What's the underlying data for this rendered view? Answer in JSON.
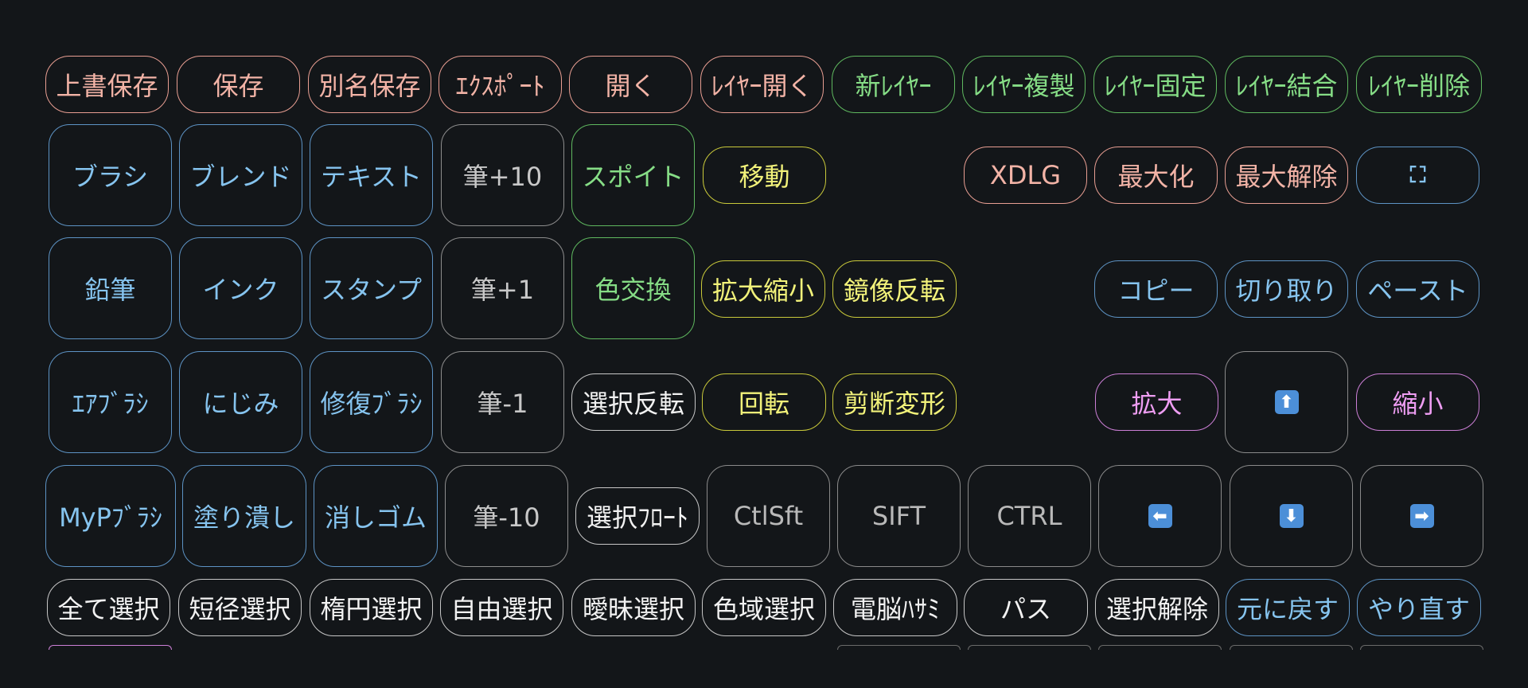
{
  "keys": [
    {
      "id": "overwrite-save",
      "label": "上書保存",
      "color": "pink"
    },
    {
      "id": "save",
      "label": "保存",
      "color": "pink"
    },
    {
      "id": "save-as",
      "label": "別名保存",
      "color": "pink"
    },
    {
      "id": "export",
      "label": "ｴｸｽﾎﾟｰﾄ",
      "color": "pink"
    },
    {
      "id": "open",
      "label": "開く",
      "color": "pink"
    },
    {
      "id": "open-layer",
      "label": "ﾚｲﾔｰ開く",
      "color": "pink"
    },
    {
      "id": "new-layer",
      "label": "新ﾚｲﾔｰ",
      "color": "green"
    },
    {
      "id": "duplicate-layer",
      "label": "ﾚｲﾔｰ複製",
      "color": "green"
    },
    {
      "id": "lock-layer",
      "label": "ﾚｲﾔｰ固定",
      "color": "green"
    },
    {
      "id": "merge-layer",
      "label": "ﾚｲﾔｰ結合",
      "color": "green"
    },
    {
      "id": "delete-layer",
      "label": "ﾚｲﾔｰ削除",
      "color": "green"
    },
    {
      "id": "brush",
      "label": "ブラシ",
      "color": "blue"
    },
    {
      "id": "blend",
      "label": "ブレンド",
      "color": "blue"
    },
    {
      "id": "text",
      "label": "テキスト",
      "color": "blue"
    },
    {
      "id": "brush-plus-10",
      "label": "筆+10",
      "color": "gray"
    },
    {
      "id": "eyedropper",
      "label": "スポイト",
      "color": "green"
    },
    {
      "id": "move",
      "label": "移動",
      "color": "yellow"
    },
    {
      "id": "xdlg",
      "label": "XDLG",
      "color": "pink"
    },
    {
      "id": "maximize",
      "label": "最大化",
      "color": "pink"
    },
    {
      "id": "unmaximize",
      "label": "最大解除",
      "color": "pink"
    },
    {
      "id": "fullscreen",
      "label": "⛶",
      "color": "blue"
    },
    {
      "id": "pencil",
      "label": "鉛筆",
      "color": "blue"
    },
    {
      "id": "ink",
      "label": "インク",
      "color": "blue"
    },
    {
      "id": "stamp",
      "label": "スタンプ",
      "color": "blue"
    },
    {
      "id": "brush-plus-1",
      "label": "筆+1",
      "color": "gray"
    },
    {
      "id": "color-swap",
      "label": "色交換",
      "color": "green"
    },
    {
      "id": "scale",
      "label": "拡大縮小",
      "color": "yellow"
    },
    {
      "id": "mirror",
      "label": "鏡像反転",
      "color": "yellow"
    },
    {
      "id": "copy",
      "label": "コピー",
      "color": "blue"
    },
    {
      "id": "cut",
      "label": "切り取り",
      "color": "blue"
    },
    {
      "id": "paste",
      "label": "ペースト",
      "color": "blue"
    },
    {
      "id": "airbrush",
      "label": "ｴｱﾌﾞﾗｼ",
      "color": "blue"
    },
    {
      "id": "blur",
      "label": "にじみ",
      "color": "blue"
    },
    {
      "id": "healing-brush",
      "label": "修復ﾌﾞﾗｼ",
      "color": "blue"
    },
    {
      "id": "brush-minus-1",
      "label": "筆-1",
      "color": "gray"
    },
    {
      "id": "invert-selection",
      "label": "選択反転",
      "color": "white"
    },
    {
      "id": "rotate",
      "label": "回転",
      "color": "yellow"
    },
    {
      "id": "shear",
      "label": "剪断変形",
      "color": "yellow"
    },
    {
      "id": "zoom-in",
      "label": "拡大",
      "color": "violet"
    },
    {
      "id": "arrow-up",
      "label": "⬆",
      "color": "darkgray",
      "icon": "arrow-up-icon"
    },
    {
      "id": "zoom-out",
      "label": "縮小",
      "color": "violet"
    },
    {
      "id": "my-brush",
      "label": "MyPﾌﾞﾗｼ",
      "color": "blue"
    },
    {
      "id": "fill",
      "label": "塗り潰し",
      "color": "blue"
    },
    {
      "id": "eraser",
      "label": "消しゴム",
      "color": "blue"
    },
    {
      "id": "brush-minus-10",
      "label": "筆-10",
      "color": "gray"
    },
    {
      "id": "float-selection",
      "label": "選択ﾌﾛｰﾄ",
      "color": "white"
    },
    {
      "id": "ctrl-shift",
      "label": "CtlSft",
      "color": "darkgray"
    },
    {
      "id": "shift",
      "label": "SIFT",
      "color": "darkgray"
    },
    {
      "id": "ctrl",
      "label": "CTRL",
      "color": "darkgray"
    },
    {
      "id": "arrow-left",
      "label": "⬅",
      "color": "darkgray",
      "icon": "arrow-left-icon"
    },
    {
      "id": "arrow-down",
      "label": "⬇",
      "color": "darkgray",
      "icon": "arrow-down-icon"
    },
    {
      "id": "arrow-right",
      "label": "➡",
      "color": "darkgray",
      "icon": "arrow-right-icon"
    },
    {
      "id": "select-all",
      "label": "全て選択",
      "color": "white"
    },
    {
      "id": "rect-select",
      "label": "短径選択",
      "color": "white"
    },
    {
      "id": "ellipse-select",
      "label": "楕円選択",
      "color": "white"
    },
    {
      "id": "free-select",
      "label": "自由選択",
      "color": "white"
    },
    {
      "id": "fuzzy-select",
      "label": "曖昧選択",
      "color": "white"
    },
    {
      "id": "color-select",
      "label": "色域選択",
      "color": "white"
    },
    {
      "id": "intelligent-scissors",
      "label": "電脳ﾊｻﾐ",
      "color": "white"
    },
    {
      "id": "path",
      "label": "パス",
      "color": "white"
    },
    {
      "id": "deselect",
      "label": "選択解除",
      "color": "white"
    },
    {
      "id": "undo",
      "label": "元に戻す",
      "color": "blue"
    },
    {
      "id": "redo",
      "label": "やり直す",
      "color": "blue"
    }
  ]
}
